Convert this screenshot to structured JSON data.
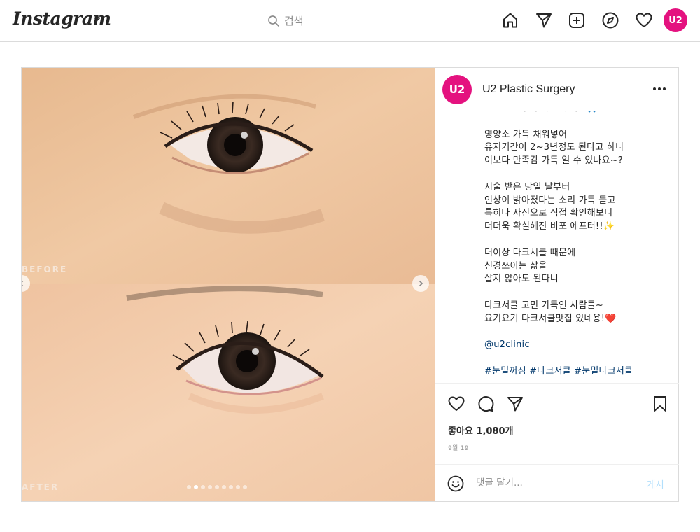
{
  "nav": {
    "logo": "Instagram",
    "search_placeholder": "검색",
    "avatar_text": "U2",
    "icons": [
      "home-icon",
      "direct-icon",
      "new-post-icon",
      "explore-icon",
      "activity-icon"
    ]
  },
  "post": {
    "username": "U2 Plastic Surgery",
    "avatar_text": "U2",
    "media": {
      "before_label": "BEFORE",
      "after_label": "AFTER",
      "carousel_count": 9,
      "carousel_active_index": 1
    },
    "caption_lines": [
      "#눈밑도 꾸저 봇고 있어요🙏🏼",
      "",
      "영양소 가득 채워넣어",
      "유지기간이 2~3년정도 된다고 하니",
      "이보다 만족감 가득 일 수 있나요~?",
      "",
      "시술 받은 당일 날부터",
      "인상이 밝아졌다는 소리 가득 듣고",
      "특히나 사진으로 직접 확인해보니",
      "더더욱 확실해진 비포 에프터!!✨",
      "",
      "더이상 다크서클 때문에",
      "신경쓰이는 삶을",
      "살지 않아도 된다니",
      "",
      "다크서클 고민 가득인 사람들~",
      "요기요기 다크서클맛집 있네용!❤️",
      "",
      "@u2clinic",
      "",
      "#눈밑꺼짐 #다크서클 #눈밑다크서클"
    ],
    "likes": "좋아요 1,080개",
    "date": "9월 19",
    "comment_placeholder": "댓글 달기...",
    "post_button": "게시"
  },
  "colors": {
    "brand_pink": "#e4127f",
    "link": "#00376b",
    "muted": "#8e8e8e",
    "post_button_disabled": "#b2dffc"
  }
}
